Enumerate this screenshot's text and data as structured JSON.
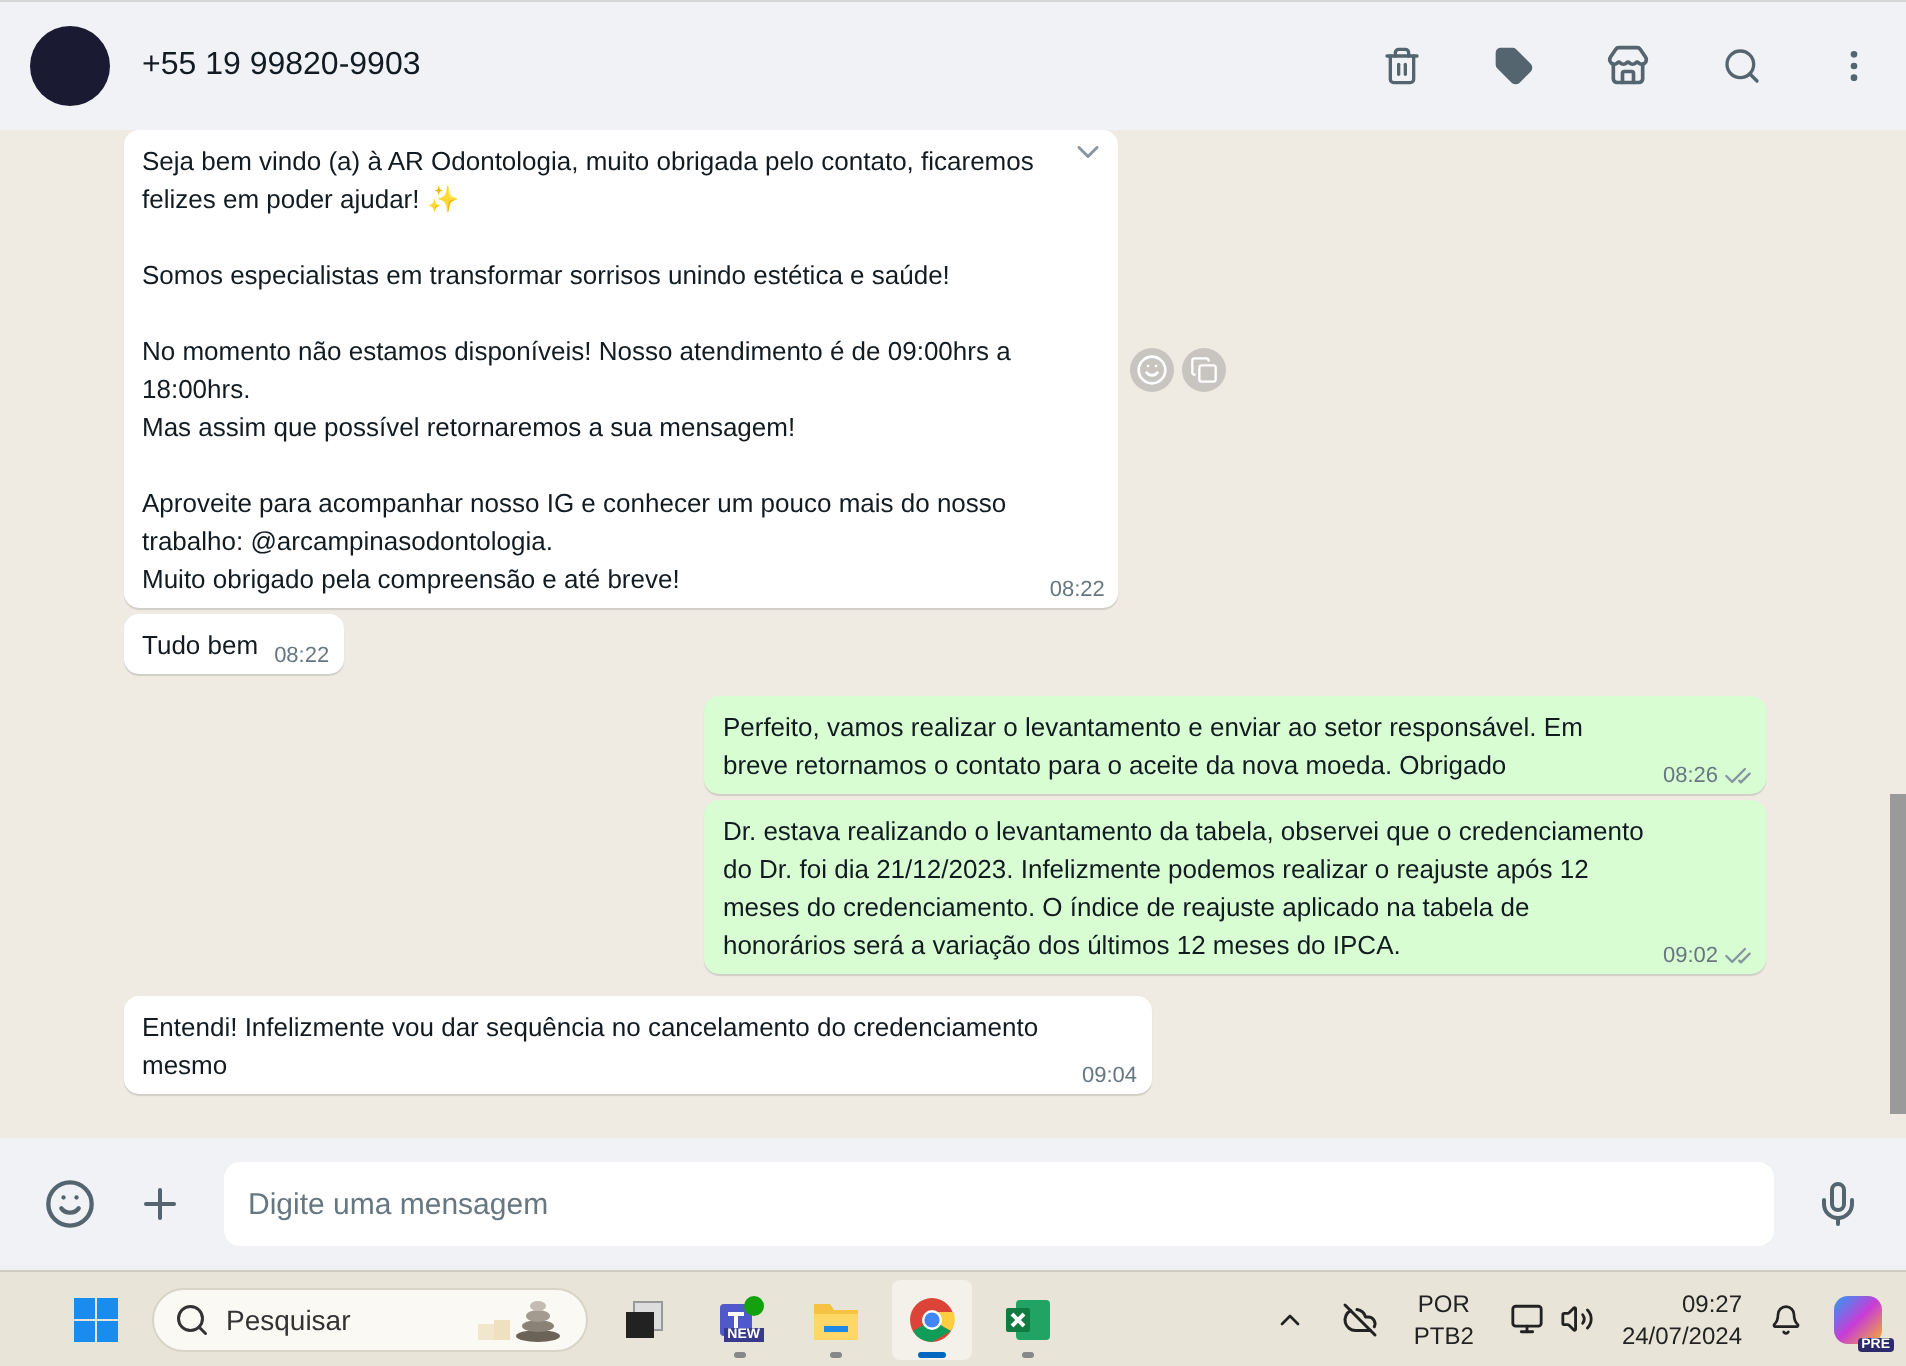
{
  "header": {
    "contact": "+55 19 99820-9903"
  },
  "messages": [
    {
      "kind": "in",
      "text": "Seja bem vindo (a) à AR Odontologia, muito obrigada pelo contato, ficaremos\nfelizes em poder ajudar! ✨\n\nSomos especialistas em transformar sorrisos unindo estética e saúde!\n\nNo momento não estamos disponíveis! Nosso atendimento é de 09:00hrs a\n18:00hrs.\nMas assim que possível retornaremos a sua mensagem!\n\nAproveite para acompanhar nosso IG e conhecer um pouco mais do nosso\ntrabalho: @arcampinasodontologia.\nMuito obrigado pela compreensão e até breve!",
      "time": "08:22",
      "hovered": true
    },
    {
      "kind": "in",
      "text": "Tudo bem",
      "time": "08:22",
      "hovered": false
    },
    {
      "kind": "out",
      "text": "Perfeito, vamos realizar o levantamento e enviar ao setor responsável. Em breve retornamos o contato para o aceite da nova moeda. Obrigado",
      "time": "08:26",
      "hovered": false
    },
    {
      "kind": "out",
      "text": "Dr. estava realizando o levantamento da tabela, observei que o credenciamento do Dr. foi dia 21/12/2023. Infelizmente podemos realizar o reajuste após 12 meses do credenciamento. O índice de reajuste aplicado na tabela de honorários será a variação dos últimos 12 meses do IPCA.",
      "time": "09:02",
      "hovered": false
    },
    {
      "kind": "in",
      "text": "Entendi! Infelizmente vou dar sequência no cancelamento do credenciamento mesmo",
      "time": "09:04",
      "hovered": false
    }
  ],
  "composer": {
    "placeholder": "Digite uma mensagem"
  },
  "taskbar": {
    "search_placeholder": "Pesquisar",
    "apps": [
      {
        "kind": "taskview",
        "selected": false
      },
      {
        "kind": "teams",
        "selected": false,
        "badge": "NEW"
      },
      {
        "kind": "folder",
        "selected": false
      },
      {
        "kind": "chrome",
        "selected": true
      },
      {
        "kind": "excel",
        "selected": false
      }
    ],
    "language": "POR",
    "layout": "PTB2",
    "time": "09:27",
    "date": "24/07/2024",
    "copilot_badge": "PRE"
  }
}
